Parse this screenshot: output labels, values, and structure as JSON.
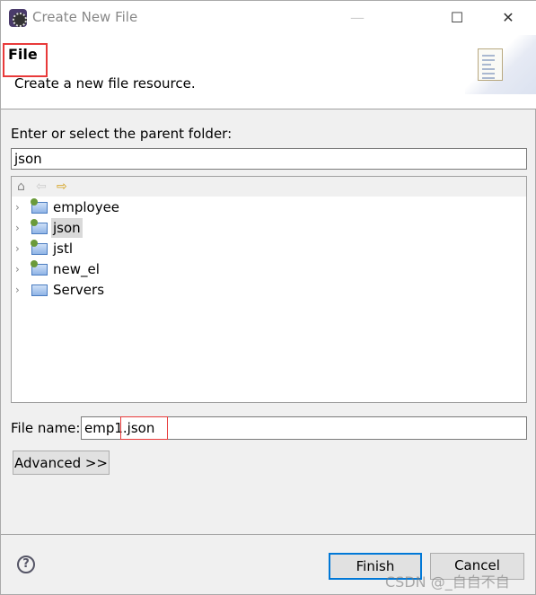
{
  "window": {
    "title": "Create New File",
    "minimize": "—",
    "maximize": "☐",
    "close": "✕"
  },
  "header": {
    "title": "File",
    "description": "Create a new file resource."
  },
  "parent": {
    "label": "Enter or select the parent folder:",
    "value": "json"
  },
  "tree": {
    "toolbar": {
      "home": "⌂",
      "back": "⇦",
      "forward": "⇨"
    },
    "items": [
      {
        "label": "employee",
        "type": "project"
      },
      {
        "label": "json",
        "type": "project",
        "selected": true
      },
      {
        "label": "jstl",
        "type": "project"
      },
      {
        "label": "new_el",
        "type": "project"
      },
      {
        "label": "Servers",
        "type": "folder"
      }
    ]
  },
  "file_name": {
    "label": "File name:",
    "value": "emp1.json"
  },
  "buttons": {
    "advanced": "Advanced >>",
    "finish": "Finish",
    "cancel": "Cancel",
    "help": "?"
  },
  "watermark": "CSDN @_自自不自",
  "colors": {
    "annotation": "#e83a3a",
    "default_button_border": "#0078d7"
  }
}
